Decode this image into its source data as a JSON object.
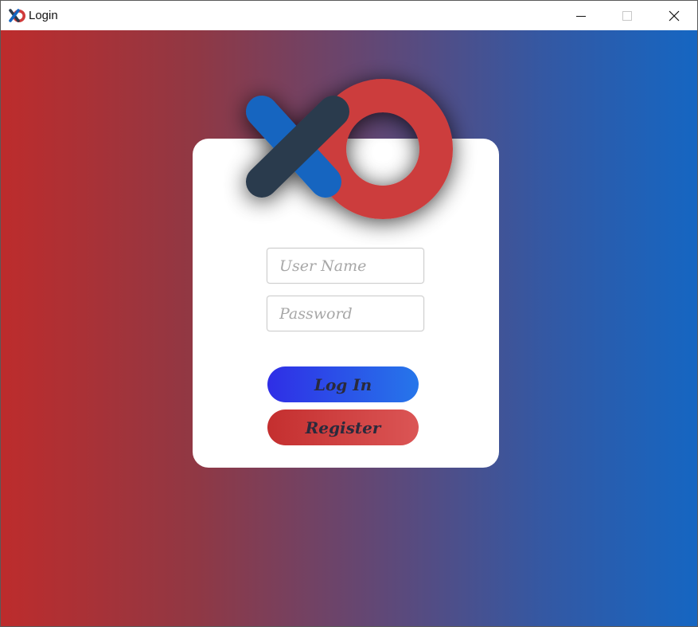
{
  "window": {
    "title": "Login",
    "icon": "xo-logo-icon",
    "controls": [
      "minimize-icon",
      "maximize-icon",
      "close-icon"
    ]
  },
  "logo": {
    "icon": "xo-logo",
    "colors": {
      "x_left": "#1565c0",
      "x_right": "#2c3a4d",
      "o": "#cc3e3e"
    }
  },
  "form": {
    "username": {
      "value": "",
      "placeholder": "User Name"
    },
    "password": {
      "value": "",
      "placeholder": "Password"
    },
    "login_label": "Log In",
    "register_label": "Register"
  },
  "colors": {
    "bg_left": "#bd2c2c",
    "bg_right": "#1566c2",
    "login_button": "#2f2ee6",
    "register_button": "#c42f2f",
    "card": "#ffffff"
  }
}
